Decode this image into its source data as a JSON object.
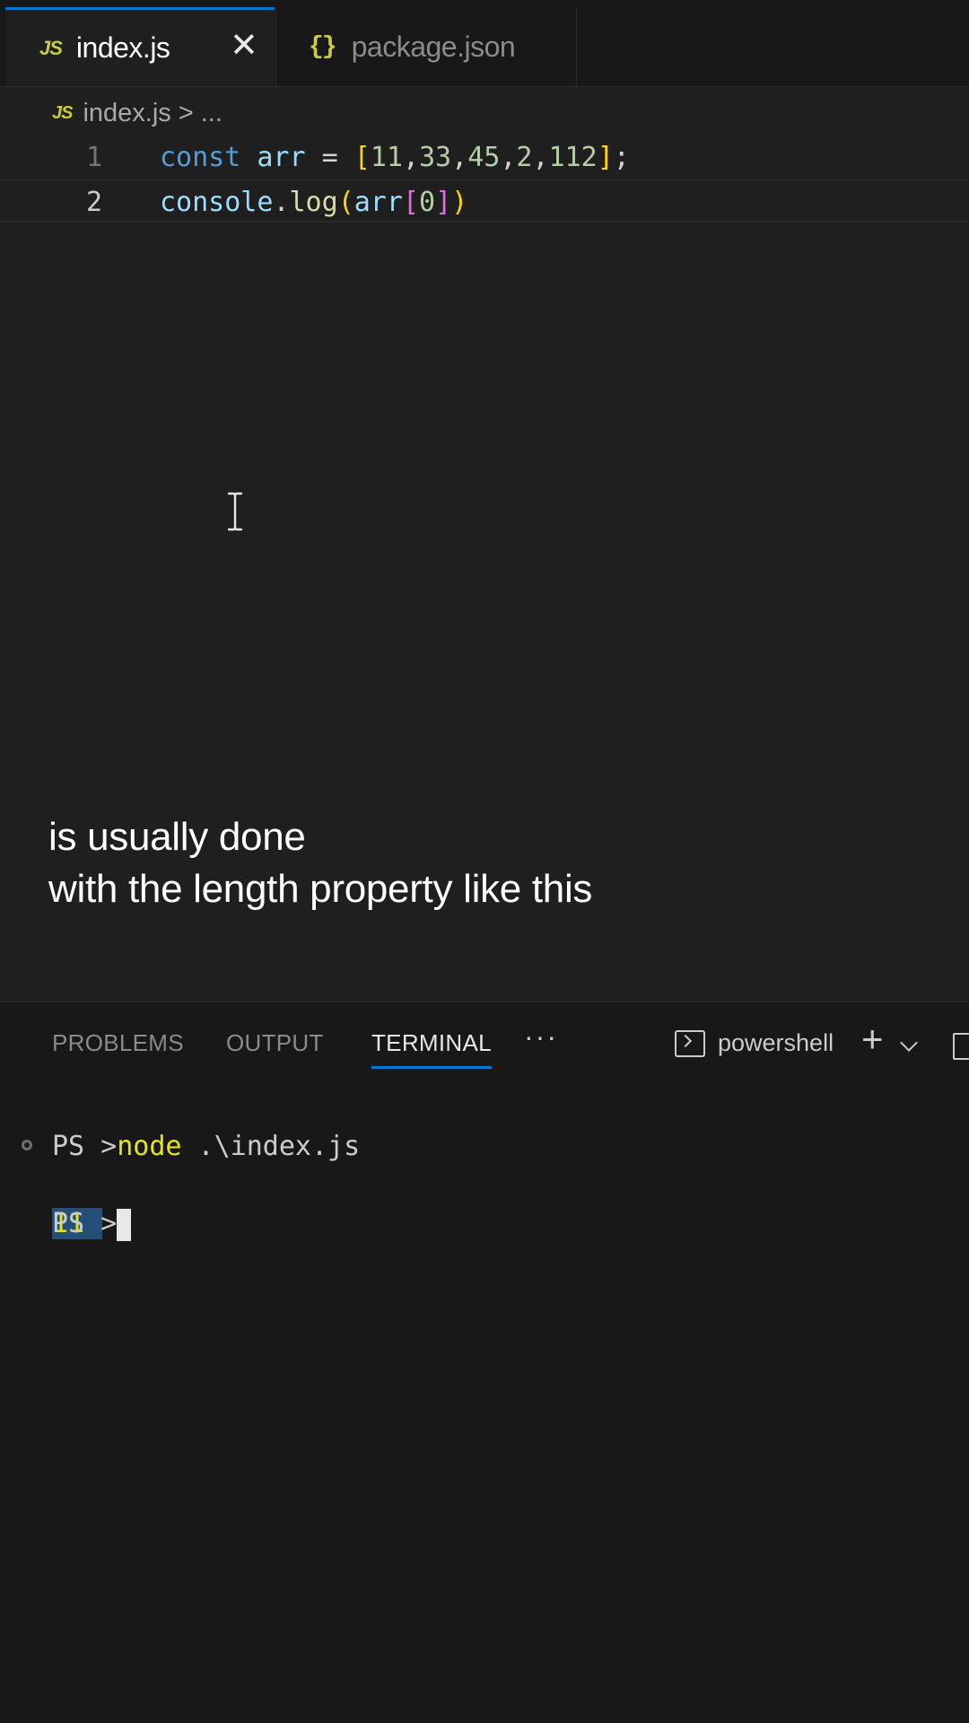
{
  "tabs": [
    {
      "icon": "JS",
      "label": "index.js",
      "close": "✕"
    },
    {
      "icon": "{}",
      "label": "package.json"
    }
  ],
  "breadcrumb": {
    "icon": "JS",
    "file": "index.js",
    "separator": ">",
    "rest": "..."
  },
  "editor": {
    "lines": [
      {
        "number": "1",
        "text": "const arr = [11,33,45,2,112];"
      },
      {
        "number": "2",
        "text": "console.log(arr[0])"
      }
    ]
  },
  "caption": {
    "line1": "is usually done",
    "line2": "with the length property like this"
  },
  "panel": {
    "tabs": [
      "PROBLEMS",
      "OUTPUT",
      "TERMINAL"
    ],
    "active_tab": "TERMINAL",
    "more": "···",
    "shell_name": "powershell",
    "add": "+"
  },
  "terminal": {
    "prompt": "PS >",
    "command": "node",
    "args": " .\\index.js",
    "output": "11",
    "prompt2": "PS >"
  },
  "colors": {
    "accent": "#0078d4",
    "editor_bg": "#1f1f1f",
    "panel_bg": "#181818",
    "keyword": "#569cd6",
    "variable": "#9cdcfe",
    "number": "#b5cea8",
    "function": "#dcdcaa",
    "bracket_gold": "#ffd700",
    "bracket_purple": "#da70d6",
    "terminal_yellow": "#e5e510",
    "selection": "#264f78"
  },
  "icons": {
    "tab1": "javascript-file-icon",
    "tab2": "json-file-icon",
    "close": "close-icon",
    "shell": "terminal-icon",
    "add": "plus-icon",
    "dropdown": "chevron-down-icon",
    "split": "split-terminal-icon",
    "cursor": "text-cursor-icon"
  }
}
